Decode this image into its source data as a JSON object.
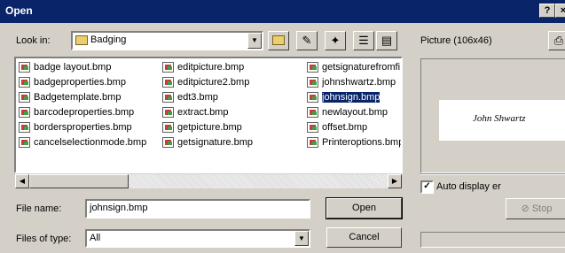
{
  "window": {
    "title": "Open",
    "help_label": "?",
    "close_label": "×"
  },
  "lookin": {
    "label": "Look in:",
    "value": "Badging"
  },
  "toolbar": {
    "up_icon": "up-folder-icon",
    "favorites_icon": "favorites-icon",
    "new_folder_icon": "new-folder-icon",
    "list_icon": "list-view-icon",
    "details_icon": "details-view-icon"
  },
  "files": {
    "col1": [
      "badge layout.bmp",
      "badgeproperties.bmp",
      "Badgetemplate.bmp",
      "barcodeproperties.bmp",
      "bordersproperties.bmp",
      "cancelselectionmode.bmp"
    ],
    "col2": [
      "editpicture.bmp",
      "editpicture2.bmp",
      "edt3.bmp",
      "extract.bmp",
      "getpicture.bmp",
      "getsignature.bmp"
    ],
    "col3": [
      "getsignaturefromfi",
      "johnshwartz.bmp",
      "johnsign.bmp",
      "newlayout.bmp",
      "offset.bmp",
      "Printeroptions.bmp"
    ],
    "selected": "johnsign.bmp"
  },
  "filename": {
    "label": "File name:",
    "value": "johnsign.bmp"
  },
  "filetype": {
    "label": "Files of type:",
    "value": "All"
  },
  "buttons": {
    "open": "Open",
    "cancel": "Cancel"
  },
  "preview": {
    "label": "Picture (106x46)",
    "signature_text": "John Shwartz",
    "auto_display_label": "Auto display er",
    "auto_display_checked": true,
    "stop_label": "Stop"
  }
}
